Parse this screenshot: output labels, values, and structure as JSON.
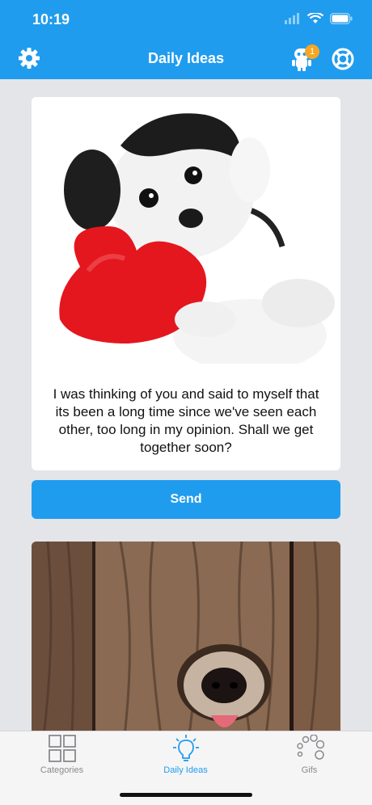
{
  "status_bar": {
    "time": "10:19"
  },
  "header": {
    "title": "Daily Ideas",
    "notification_count": "1"
  },
  "colors": {
    "accent": "#209cee",
    "badge": "#f5a623",
    "background": "#e3e5e8"
  },
  "cards": [
    {
      "image": "puppy-with-red-heart",
      "message": "I was thinking of you and said to myself that its been a long time since we've seen each other, too long in my opinion.  Shall we get together soon?"
    },
    {
      "image": "dog-nose-through-wood-fence"
    }
  ],
  "send_button": {
    "label": "Send"
  },
  "tabs": [
    {
      "label": "Categories",
      "icon": "grid-icon",
      "active": false
    },
    {
      "label": "Daily Ideas",
      "icon": "lightbulb-icon",
      "active": true
    },
    {
      "label": "Gifs",
      "icon": "spinner-dots-icon",
      "active": false
    }
  ]
}
